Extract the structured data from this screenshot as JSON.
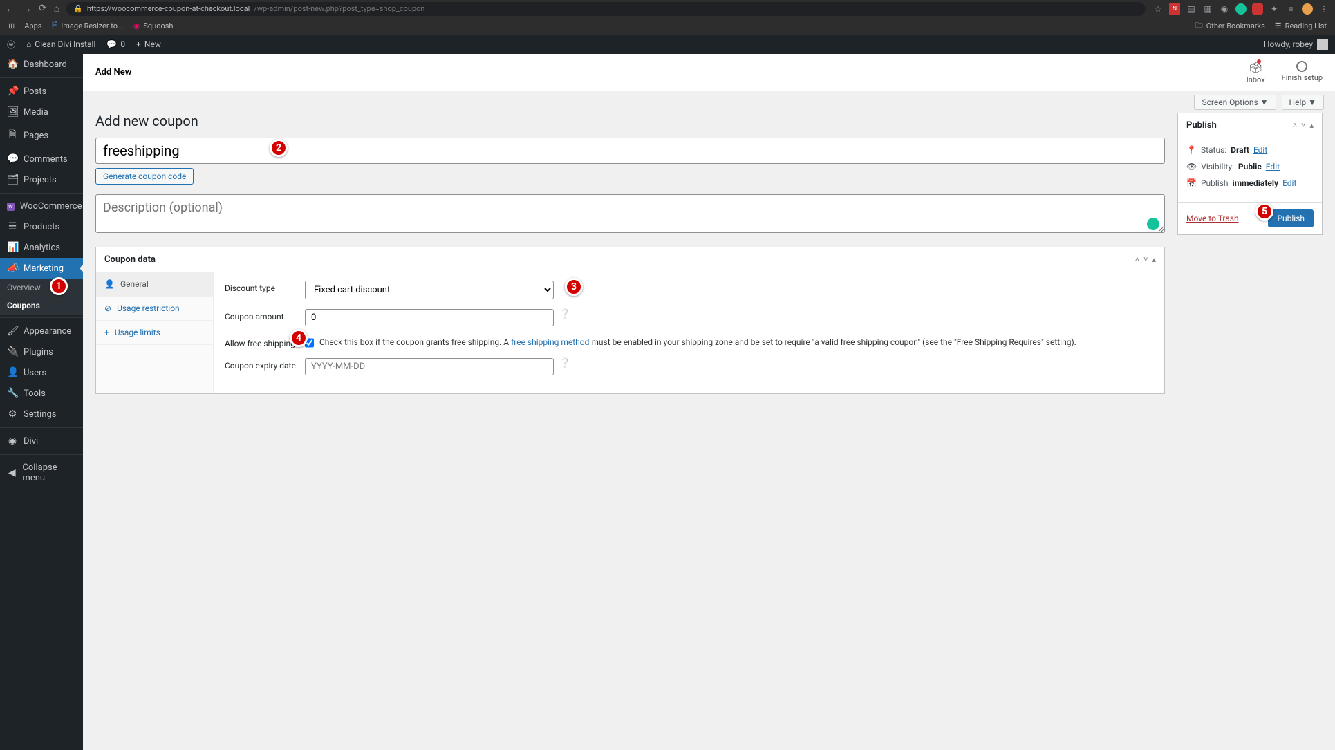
{
  "browser": {
    "url_host": "https://woocommerce-coupon-at-checkout.local",
    "url_path": "/wp-admin/post-new.php?post_type=shop_coupon",
    "bookmarks": [
      "Apps",
      "Image Resizer to...",
      "Squoosh"
    ],
    "other_bookmarks": "Other Bookmarks",
    "reading_list": "Reading List"
  },
  "adminbar": {
    "site": "Clean Divi Install",
    "comments": "0",
    "new": "New",
    "howdy": "Howdy, robey"
  },
  "sidebar": {
    "items": [
      {
        "label": "Dashboard",
        "icon": "⌂"
      },
      {
        "label": "Posts",
        "icon": "✎"
      },
      {
        "label": "Media",
        "icon": "☐"
      },
      {
        "label": "Pages",
        "icon": "🗎"
      },
      {
        "label": "Comments",
        "icon": "💬"
      },
      {
        "label": "Projects",
        "icon": "📌"
      },
      {
        "label": "WooCommerce",
        "icon": "w"
      },
      {
        "label": "Products",
        "icon": "☰"
      },
      {
        "label": "Analytics",
        "icon": "📊"
      },
      {
        "label": "Marketing",
        "icon": "📣"
      },
      {
        "label": "Appearance",
        "icon": "🖌"
      },
      {
        "label": "Plugins",
        "icon": "⚡"
      },
      {
        "label": "Users",
        "icon": "👤"
      },
      {
        "label": "Tools",
        "icon": "🔧"
      },
      {
        "label": "Settings",
        "icon": "⚙"
      },
      {
        "label": "Divi",
        "icon": "◉"
      },
      {
        "label": "Collapse menu",
        "icon": "◀"
      }
    ],
    "submenu": [
      "Overview",
      "Coupons"
    ]
  },
  "header": {
    "add_new": "Add New",
    "inbox": "Inbox",
    "finish": "Finish setup",
    "screen_options": "Screen Options",
    "help": "Help"
  },
  "page": {
    "title": "Add new coupon",
    "coupon_code": "freeshipping",
    "generate_btn": "Generate coupon code",
    "desc_placeholder": "Description (optional)"
  },
  "coupon_data": {
    "heading": "Coupon data",
    "tabs": [
      "General",
      "Usage restriction",
      "Usage limits"
    ],
    "fields": {
      "discount_type_label": "Discount type",
      "discount_type_value": "Fixed cart discount",
      "coupon_amount_label": "Coupon amount",
      "coupon_amount_value": "0",
      "allow_free_label": "Allow free shipping",
      "allow_free_desc1": "Check this box if the coupon grants free shipping. A ",
      "allow_free_link": "free shipping method",
      "allow_free_desc2": " must be enabled in your shipping zone and be set to require \"a valid free shipping coupon\" (see the \"Free Shipping Requires\" setting).",
      "expiry_label": "Coupon expiry date",
      "expiry_placeholder": "YYYY-MM-DD"
    }
  },
  "publish": {
    "heading": "Publish",
    "status_label": "Status:",
    "status_value": "Draft",
    "visibility_label": "Visibility:",
    "visibility_value": "Public",
    "publish_label": "Publish",
    "publish_value": "immediately",
    "edit": "Edit",
    "trash": "Move to Trash",
    "button": "Publish"
  },
  "badges": [
    "1",
    "2",
    "3",
    "4",
    "5"
  ]
}
